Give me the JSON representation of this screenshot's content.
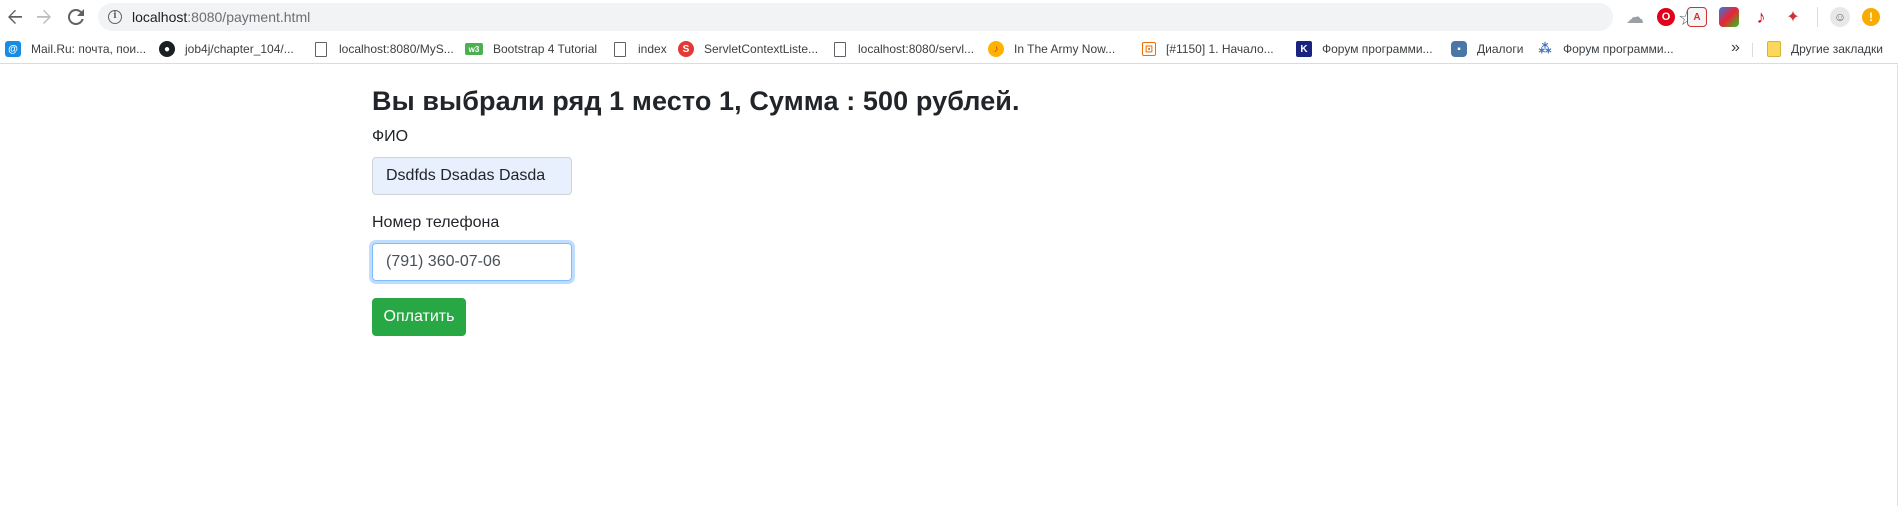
{
  "browser": {
    "url_host": "localhost",
    "url_path": ":8080/payment.html",
    "icons": {
      "back": "arrow-left-icon",
      "forward": "arrow-right-icon",
      "reload": "reload-icon",
      "info": "info-icon",
      "bookmark_star": "star-icon"
    }
  },
  "bookmarks": {
    "items": [
      {
        "label": "Mail.Ru: почта, пои...",
        "icon": "mailru-icon"
      },
      {
        "label": "job4j/chapter_104/...",
        "icon": "github-icon"
      },
      {
        "label": "localhost:8080/MyS...",
        "icon": "page-icon"
      },
      {
        "label": "Bootstrap 4 Tutorial",
        "icon": "w3schools-icon"
      },
      {
        "label": "index",
        "icon": "page-icon"
      },
      {
        "label": "ServletContextListe...",
        "icon": "servlet-icon"
      },
      {
        "label": "localhost:8080/servl...",
        "icon": "page-icon"
      },
      {
        "label": "In The Army Now...",
        "icon": "music-icon"
      },
      {
        "label": "[#1150] 1. Начало...",
        "icon": "task-icon"
      },
      {
        "label": "Форум программи...",
        "icon": "forum-icon"
      },
      {
        "label": "Диалоги",
        "icon": "dialog-icon"
      },
      {
        "label": "Форум программи...",
        "icon": "forum2-icon"
      }
    ],
    "more": "»",
    "other": "Другие закладки"
  },
  "page": {
    "title": "Вы выбрали ряд 1 место 1, Сумма : 500 рублей.",
    "name_label": "ФИО",
    "name_value": "Dsdfds Dsadas Dasda",
    "phone_label": "Номер телефона",
    "phone_value": "(791) 360-07-06",
    "pay_button": "Оплатить"
  },
  "colors": {
    "primary_button": "#28a745",
    "focus_border": "#80bdff",
    "autofill_bg": "#e8f0fe"
  }
}
